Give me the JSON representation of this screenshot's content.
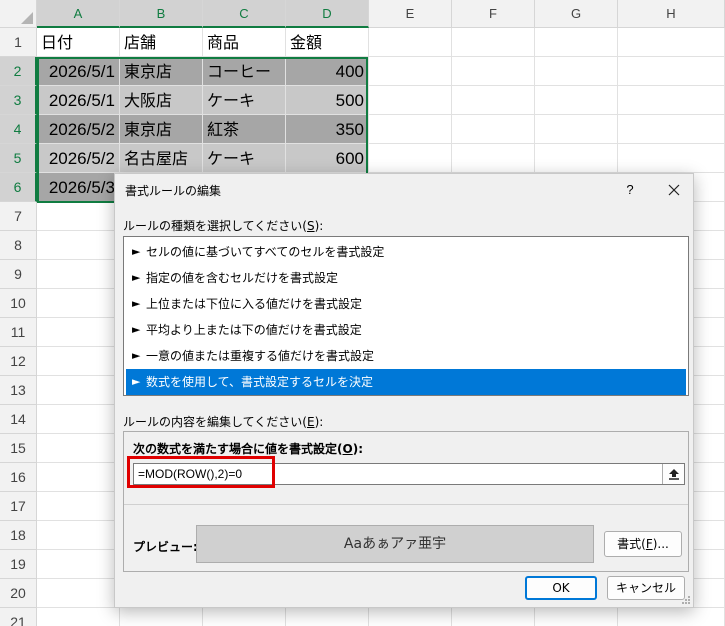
{
  "sheet": {
    "columns": [
      "A",
      "B",
      "C",
      "D",
      "E",
      "F",
      "G",
      "H"
    ],
    "rows": [
      "1",
      "2",
      "3",
      "4",
      "5",
      "6",
      "7",
      "8",
      "9",
      "10",
      "11",
      "12",
      "13",
      "14",
      "15",
      "16",
      "17",
      "18",
      "19",
      "20",
      "21"
    ],
    "header_row": [
      "日付",
      "店舗",
      "商品",
      "金額"
    ],
    "data": [
      [
        "2026/5/1",
        "東京店",
        "コーヒー",
        "400"
      ],
      [
        "2026/5/1",
        "大阪店",
        "ケーキ",
        "500"
      ],
      [
        "2026/5/2",
        "東京店",
        "紅茶",
        "350"
      ],
      [
        "2026/5/2",
        "名古屋店",
        "ケーキ",
        "600"
      ],
      [
        "2026/5/3",
        "",
        "",
        ""
      ]
    ],
    "selection_color": "#107c41",
    "shade_dark": "#a6a6a6",
    "shade_light": "#c8c8c8"
  },
  "dialog": {
    "title": "書式ルールの編集",
    "help": "?",
    "rule_type_label": "ルールの種類を選択してください(",
    "rule_type_key": "S",
    "rule_type_suffix": "):",
    "rule_types": [
      "セルの値に基づいてすべてのセルを書式設定",
      "指定の値を含むセルだけを書式設定",
      "上位または下位に入る値だけを書式設定",
      "平均より上または下の値だけを書式設定",
      "一意の値または重複する値だけを書式設定",
      "数式を使用して、書式設定するセルを決定"
    ],
    "selected_rule_index": 5,
    "rule_edit_label": "ルールの内容を編集してください(",
    "rule_edit_key": "E",
    "rule_edit_suffix": "):",
    "formula_label": "次の数式を満たす場合に値を書式設定(",
    "formula_key": "O",
    "formula_suffix": "):",
    "formula": "=MOD(ROW(),2)=0",
    "preview_label": "プレビュー:",
    "preview_text": "Aaあぁアァ亜宇",
    "format_button": "書式(",
    "format_key": "F",
    "format_suffix": ")...",
    "ok_button": "OK",
    "cancel_button": "キャンセル",
    "accent_color": "#0078d7",
    "highlight_color": "#e00000"
  }
}
